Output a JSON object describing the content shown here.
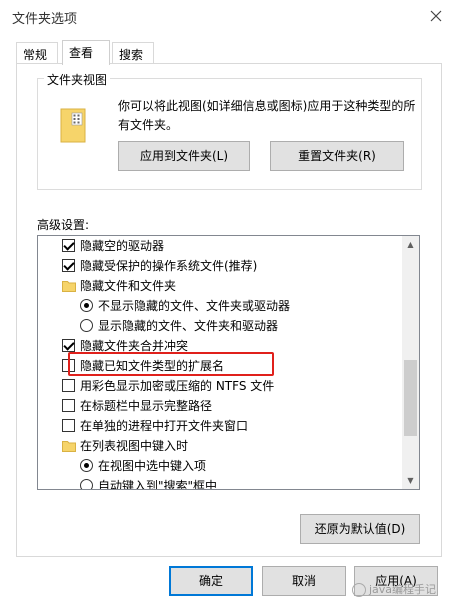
{
  "window": {
    "title": "文件夹选项"
  },
  "tabs": [
    {
      "label": "常规",
      "active": false
    },
    {
      "label": "查看",
      "active": true
    },
    {
      "label": "搜索",
      "active": false
    }
  ],
  "folder_views": {
    "title": "文件夹视图",
    "description": "你可以将此视图(如详细信息或图标)应用于这种类型的所有文件夹。",
    "apply_button": "应用到文件夹(L)",
    "reset_button": "重置文件夹(R)"
  },
  "advanced": {
    "label": "高级设置:",
    "items": [
      {
        "type": "checkbox",
        "checked": true,
        "label": "隐藏空的驱动器"
      },
      {
        "type": "checkbox",
        "checked": true,
        "label": "隐藏受保护的操作系统文件(推荐)"
      },
      {
        "type": "folder",
        "label": "隐藏文件和文件夹"
      },
      {
        "type": "radio",
        "checked": true,
        "label": "不显示隐藏的文件、文件夹或驱动器"
      },
      {
        "type": "radio",
        "checked": false,
        "label": "显示隐藏的文件、文件夹和驱动器"
      },
      {
        "type": "checkbox",
        "checked": true,
        "label": "隐藏文件夹合并冲突"
      },
      {
        "type": "checkbox",
        "checked": false,
        "label": "隐藏已知文件类型的扩展名"
      },
      {
        "type": "checkbox",
        "checked": false,
        "label": "用彩色显示加密或压缩的 NTFS 文件"
      },
      {
        "type": "checkbox",
        "checked": false,
        "label": "在标题栏中显示完整路径"
      },
      {
        "type": "checkbox",
        "checked": false,
        "label": "在单独的进程中打开文件夹窗口"
      },
      {
        "type": "folder",
        "label": "在列表视图中键入时"
      },
      {
        "type": "radio",
        "checked": true,
        "label": "在视图中选中键入项"
      },
      {
        "type": "radio",
        "checked": false,
        "label": "自动键入到\"搜索\"框中"
      }
    ],
    "restore_button": "还原为默认值(D)"
  },
  "footer": {
    "ok": "确定",
    "cancel": "取消",
    "apply": "应用(A)"
  },
  "watermark": {
    "text": "java编程手记"
  },
  "colors": {
    "highlight": "#e0201b",
    "accent": "#0078d7",
    "folder": "#f6d46a"
  }
}
